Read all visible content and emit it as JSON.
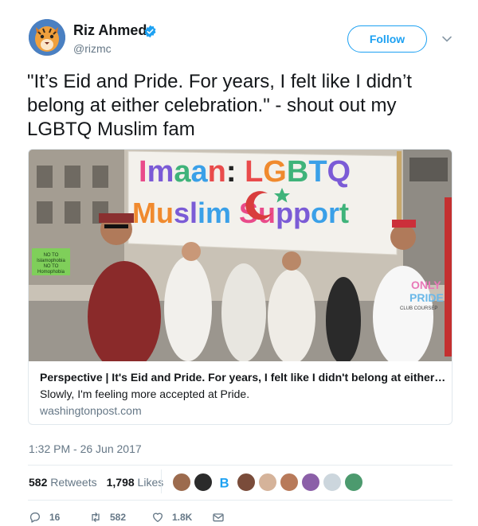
{
  "author": {
    "name": "Riz Ahmed",
    "handle": "@rizmc",
    "avatar_icon": "tiger-avatar",
    "verified_icon": "verified-badge-icon"
  },
  "follow_button": {
    "label": "Follow"
  },
  "more_menu": {
    "icon": "chevron-down-icon"
  },
  "tweet": {
    "text": "\"It’s Eid and Pride. For years, I felt like I didn’t belong at either celebration.\" - shout out my LGBTQ Muslim fam"
  },
  "link_card": {
    "image_banner_text": [
      "Imaan: LGBTQ",
      "Muslim Support"
    ],
    "image_sign_text": [
      "NO TO",
      "Islamophobia",
      "NO TO",
      "Homophobia"
    ],
    "image_shirt_text": [
      "ONLY",
      "PRIDE",
      "CLUB COURSEP"
    ],
    "title": "Perspective | It's Eid and Pride. For years, I felt like I didn't belong at either ce...",
    "description": "Slowly, I'm feeling more accepted at Pride.",
    "domain": "washingtonpost.com"
  },
  "timestamp": "1:32 PM - 26 Jun 2017",
  "stats": {
    "retweets_count": "582",
    "retweets_label": "Retweets",
    "likes_count": "1,798",
    "likes_label": "Likes"
  },
  "actions": {
    "reply_count": "16",
    "retweet_count": "582",
    "like_count": "1.8K"
  },
  "colors": {
    "accent": "#1da1f2",
    "text": "#14171a",
    "secondary": "#657786",
    "border": "#e1e8ed"
  }
}
